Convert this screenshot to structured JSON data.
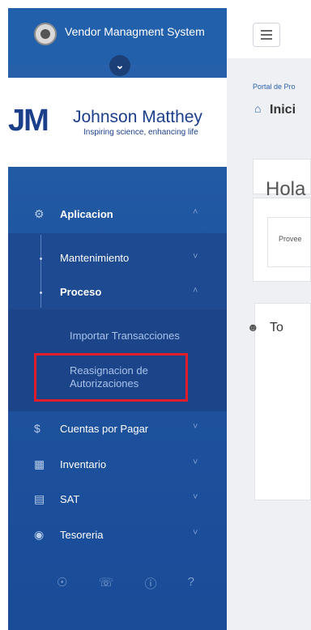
{
  "sidebar": {
    "brand_title": "Vendor Managment System",
    "toggle_icon": "chevron-down-icon",
    "logo": {
      "mark": "JM",
      "company": "Johnson Matthey",
      "tagline": "Inspiring science, enhancing life"
    },
    "menu": {
      "aplicacion": "Aplicacion",
      "mantenimiento": "Mantenimiento",
      "proceso": "Proceso",
      "importar": "Importar Transacciones",
      "reasignacion_line1": "Reasignacion de",
      "reasignacion_line2": "Autorizaciones",
      "cuentas": "Cuentas por Pagar",
      "inventario": "Inventario",
      "sat": "SAT",
      "tesoreria": "Tesoreria"
    },
    "footer_icons": [
      "globe-icon",
      "phone-icon",
      "info-icon",
      "help-icon"
    ]
  },
  "main": {
    "breadcrumb": "Portal de Pro",
    "page_title": "Inici",
    "greeting": "Hola",
    "provider_label": "Provee",
    "section_title": "To"
  },
  "colors": {
    "sidebar": "#1f55a0",
    "highlight": "#e21c2a",
    "accent": "#2a63ad"
  }
}
